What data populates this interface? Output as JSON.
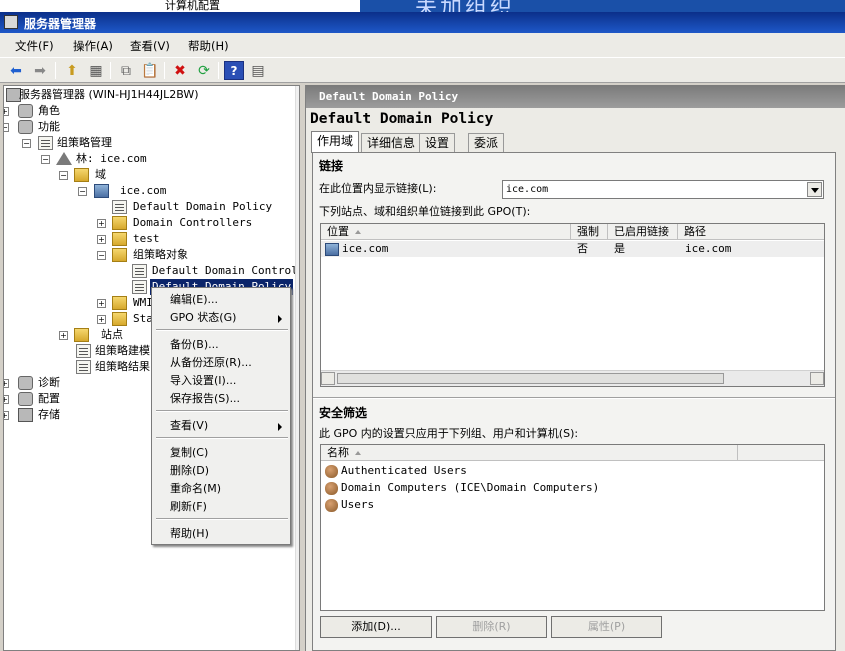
{
  "background": {
    "node_label": "计算机配置",
    "banner_text": "未加组织"
  },
  "window": {
    "title": "服务器管理器"
  },
  "menu": [
    "文件(F)",
    "操作(A)",
    "查看(V)",
    "帮助(H)"
  ],
  "toolbar": {
    "icons": [
      "back-icon",
      "forward-icon",
      "up-icon",
      "show-hide-tree-icon",
      "copy-icon",
      "paste-icon",
      "delete-icon",
      "refresh-icon",
      "help-icon",
      "properties-icon"
    ]
  },
  "tree": {
    "root": "服务器管理器 (WIN-HJ1H44JL2BW)",
    "roles": "角色",
    "features": "功能",
    "gpm": "组策略管理",
    "forest": "林: ice.com",
    "domains": "域",
    "domain": "ice.com",
    "ddp": "Default Domain Policy",
    "dc": "Domain Controllers",
    "test": "test",
    "gpo": "组策略对象",
    "gpo_ddcp": "Default Domain Controller",
    "gpo_ddp": "Default Domain Policy",
    "wmi": "WMI",
    "starter": "Sta",
    "sites": "站点",
    "modeling": "组策略建模",
    "results": "组策略结果",
    "diagnostics": "诊断",
    "config": "配置",
    "storage": "存储"
  },
  "context_menu": {
    "edit": "编辑(E)...",
    "gpo_status": "GPO 状态(G)",
    "backup": "备份(B)...",
    "restore": "从备份还原(R)...",
    "import": "导入设置(I)...",
    "save_report": "保存报告(S)...",
    "view": "查看(V)",
    "copy": "复制(C)",
    "delete": "删除(D)",
    "rename": "重命名(M)",
    "refresh": "刷新(F)",
    "help": "帮助(H)"
  },
  "right": {
    "header": "Default Domain Policy",
    "title": "Default Domain Policy",
    "tabs": [
      "作用域",
      "详细信息",
      "设置",
      "委派"
    ],
    "links": {
      "title": "链接",
      "location_label": "在此位置内显示链接(L):",
      "location_value": "ice.com",
      "linked_label": "下列站点、域和组织单位链接到此 GPO(T):",
      "columns": [
        "位置",
        "强制",
        "已启用链接",
        "路径"
      ],
      "rows": [
        {
          "location": "ice.com",
          "enforced": "否",
          "enabled": "是",
          "path": "ice.com"
        }
      ]
    },
    "security": {
      "title": "安全筛选",
      "desc": "此 GPO 内的设置只应用于下列组、用户和计算机(S):",
      "column": "名称",
      "rows": [
        "Authenticated Users",
        "Domain Computers (ICE\\Domain Computers)",
        "Users"
      ],
      "add": "添加(D)...",
      "remove": "删除(R)",
      "properties": "属性(P)"
    }
  }
}
